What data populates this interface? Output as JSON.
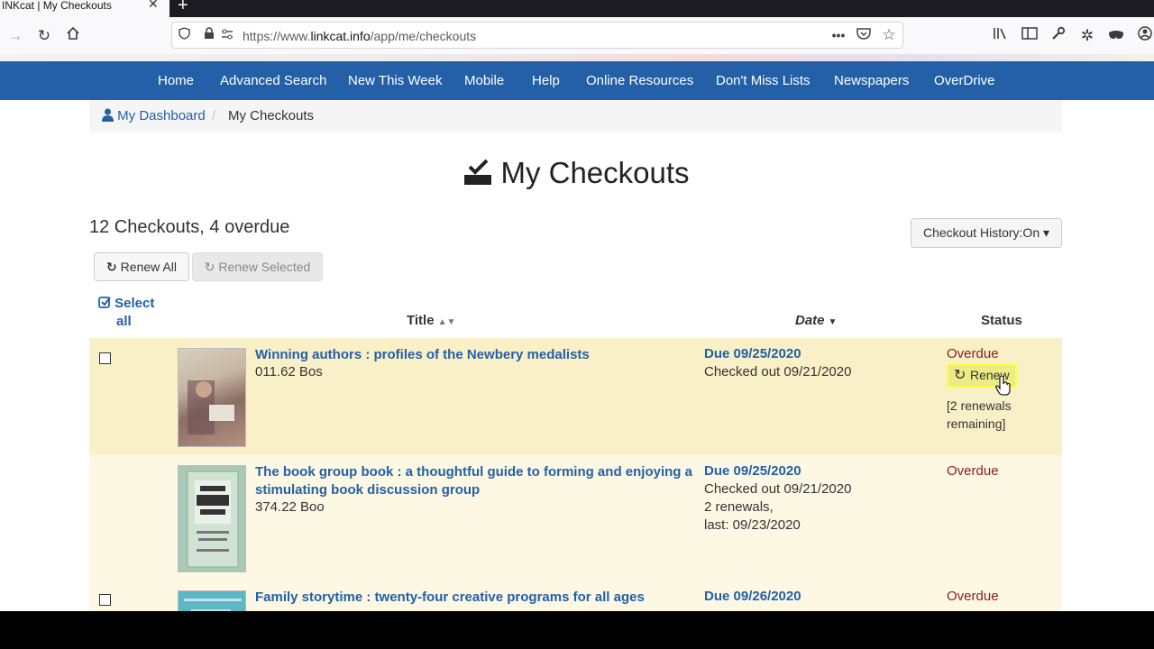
{
  "browser": {
    "tab_title": "INKcat | My Checkouts",
    "url_prefix": "https://www.",
    "url_domain": "linkcat.info",
    "url_path": "/app/me/checkouts"
  },
  "site_nav": {
    "items": [
      "Home",
      "Advanced Search",
      "New This Week",
      "Mobile",
      "Help",
      "Online Resources",
      "Don't Miss Lists",
      "Newspapers",
      "OverDrive"
    ]
  },
  "breadcrumb": {
    "dashboard": "My Dashboard",
    "current": "My Checkouts"
  },
  "page": {
    "title": "My Checkouts",
    "summary": "12 Checkouts, 4 overdue",
    "history_button": "Checkout History:On ▾",
    "renew_all": "Renew All",
    "renew_selected": "Renew Selected"
  },
  "table": {
    "select_all_1": "Select",
    "select_all_2": "all",
    "col_title": "Title",
    "col_date": "Date",
    "col_status": "Status"
  },
  "checkouts": [
    {
      "title": "Winning authors : profiles of the Newbery medalists",
      "call_number": "011.62 Bos",
      "due": "Due 09/25/2020",
      "checked_out": "Checked out 09/21/2020",
      "status": "Overdue",
      "renew_label": "Renew",
      "remaining_1": "[2 renewals",
      "remaining_2": "remaining]"
    },
    {
      "title_1": "The book group book : a thoughtful guide to forming and enjoying a",
      "title_2": "stimulating book discussion group",
      "call_number": "374.22 Boo",
      "due": "Due 09/25/2020",
      "checked_out": "Checked out 09/21/2020",
      "renewals": "2 renewals,",
      "last": "last: 09/23/2020",
      "status": "Overdue"
    },
    {
      "title": "Family storytime : twenty-four creative programs for all ages",
      "due": "Due 09/26/2020",
      "status": "Overdue"
    }
  ],
  "colors": {
    "nav_blue": "#2360a8",
    "overdue_row": "#faf0c8",
    "overdue_text": "#8b1c1c",
    "highlight": "#ffff4a"
  }
}
